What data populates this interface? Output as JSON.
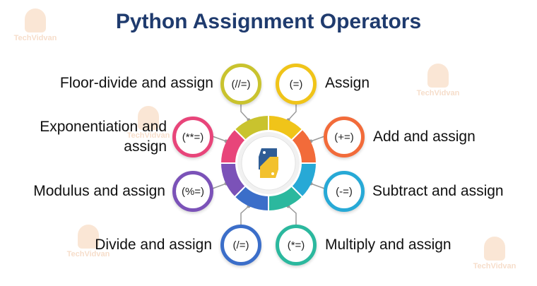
{
  "title": "Python Assignment Operators",
  "watermark": "TechVidvan",
  "operators": [
    {
      "symbol": "(//=)",
      "label": "Floor-divide and assign",
      "color": "#c9c32e"
    },
    {
      "symbol": "(=)",
      "label": "Assign",
      "color": "#f0c419"
    },
    {
      "symbol": "(**=)",
      "label": "Exponentiation and assign",
      "color": "#e8457a"
    },
    {
      "symbol": "(+=)",
      "label": "Add and assign",
      "color": "#f26b3a"
    },
    {
      "symbol": "(%=)",
      "label": "Modulus and assign",
      "color": "#7b52b8"
    },
    {
      "symbol": "(-=)",
      "label": "Subtract and assign",
      "color": "#27a9d6"
    },
    {
      "symbol": "(/=)",
      "label": "Divide and assign",
      "color": "#3b6ec9"
    },
    {
      "symbol": "(*=)",
      "label": "Multiply and assign",
      "color": "#2bb89e"
    }
  ]
}
